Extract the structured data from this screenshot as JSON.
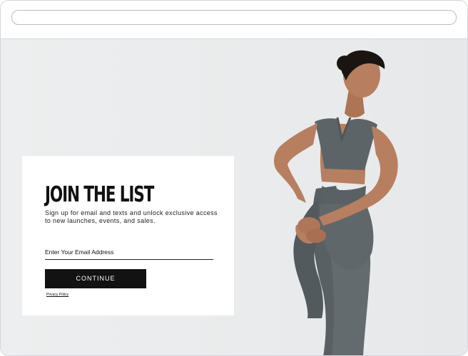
{
  "modal": {
    "title": "JOIN THE LIST",
    "description": "Sign up for email and texts and unlock exclusive access to new launches, events, and sales.",
    "email_placeholder": "Enter Your Email Address",
    "email_value": "",
    "continue_label": "CONTINUE",
    "privacy_label": "Privacy Policy"
  },
  "colors": {
    "background": "#e9ebec",
    "button": "#121212",
    "outfit": "#5d6467",
    "skin": "#b77f5f",
    "hair": "#1b1512"
  },
  "icons": [
    "browser-address-bar",
    "fitness-model-photo"
  ]
}
